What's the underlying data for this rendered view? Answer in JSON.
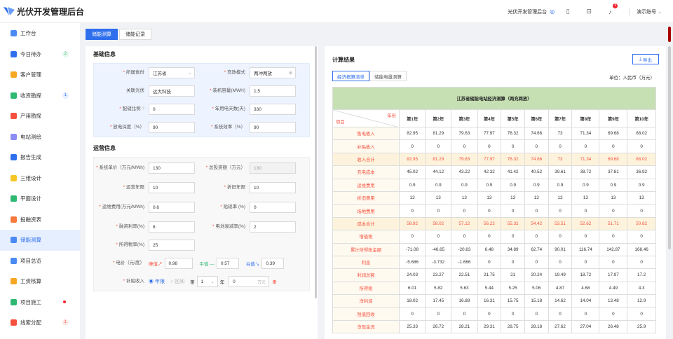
{
  "app": {
    "title": "光伏开发管理后台",
    "sys_link": "光伏开发管理后台",
    "notif_count": "3",
    "user": "演示账号"
  },
  "sidebar": [
    {
      "label": "工作台",
      "color": "#4a8af4",
      "count": "",
      "ctype": ""
    },
    {
      "label": "今日待办",
      "color": "#2f6fed",
      "count": "2",
      "ctype": "g"
    },
    {
      "label": "客户管理",
      "color": "#f5a623",
      "count": "",
      "ctype": ""
    },
    {
      "label": "收资勘探",
      "color": "#2eb872",
      "count": "1",
      "ctype": "b"
    },
    {
      "label": "产用勘探",
      "color": "#f5503d",
      "count": "",
      "ctype": ""
    },
    {
      "label": "电站测绘",
      "color": "#8c8cf5",
      "count": "",
      "ctype": ""
    },
    {
      "label": "报告生成",
      "color": "#2f6fed",
      "count": "",
      "ctype": ""
    },
    {
      "label": "三维设计",
      "color": "#f5c623",
      "count": "",
      "ctype": ""
    },
    {
      "label": "平面设计",
      "color": "#2eb872",
      "count": "",
      "ctype": ""
    },
    {
      "label": "投融资表",
      "color": "#f57a3d",
      "count": "",
      "ctype": ""
    },
    {
      "label": "储能测算",
      "color": "#4a8af4",
      "count": "",
      "ctype": ""
    },
    {
      "label": "项目总览",
      "color": "#4a8af4",
      "count": "",
      "ctype": ""
    },
    {
      "label": "工资核算",
      "color": "#f5a623",
      "count": "",
      "ctype": ""
    },
    {
      "label": "项目施工",
      "color": "#2eb872",
      "count": "",
      "ctype": "dot"
    },
    {
      "label": "线索分配",
      "color": "#f5503d",
      "count": "1",
      "ctype": "r"
    }
  ],
  "tabs": {
    "calc": "储能测算",
    "record": "储能记录"
  },
  "basic": {
    "title": "基础信息",
    "province_l": "所属省份",
    "province": "江苏省",
    "mode_l": "充放模式",
    "mode": "两冲两放",
    "link_l": "关联光伏",
    "link": "远大科技",
    "cap_l": "装机容量(MWH)",
    "cap": "1.5",
    "ratio_l": "配储比例",
    "ratio": "0",
    "days_l": "年用电天数(天)",
    "days": "330",
    "dod_l": "放电深度（%）",
    "dod": "90",
    "eff_l": "系统效率（%）",
    "eff": "90"
  },
  "ops": {
    "title": "运营信息",
    "price_l": "系统单价（万元/MWh)",
    "price": "130",
    "invest_l": "总投资额（万元）",
    "invest": "130",
    "years_l": "运营年限",
    "years": "10",
    "dep_l": "折旧年限",
    "dep": "10",
    "opex_l": "运维费用(万元/MWh)",
    "opex": "0.6",
    "rate_l": "贴现率 (%)",
    "rate": "0",
    "fin_l": "融资利率(%)",
    "fin": "8",
    "decay_l": "电池衰减率(%)",
    "decay": "2",
    "tax_l": "所得税率(%)",
    "tax": "25",
    "elec_l": "电价（元/度）",
    "peak_l": "峰值↗",
    "peak": "0.98",
    "flat_l": "平值 —",
    "flat": "0.57",
    "valley_l": "谷值↘",
    "valley": "0.39",
    "sub_l": "补贴收入",
    "sub_opt1": "年限",
    "sub_opt2": "区间",
    "sub_first": "第",
    "sub_year": "1",
    "sub_yr": "年",
    "sub_val": "0",
    "sub_unit": "万元"
  },
  "result": {
    "title": "计算结果",
    "export": "导出",
    "tab1": "经济概算清单",
    "tab2": "储能电量测算",
    "unit": "单位：人民币（万元）",
    "table_title": "江苏省储能电站经济测算（两充两放）",
    "corner_top": "年份",
    "corner_bottom": "项目",
    "years": [
      "第1年",
      "第2年",
      "第3年",
      "第4年",
      "第5年",
      "第6年",
      "第7年",
      "第8年",
      "第9年",
      "第10年"
    ],
    "rows": [
      {
        "name": "售电收入",
        "hl": false,
        "v": [
          "82.95",
          "81.29",
          "79.63",
          "77.97",
          "76.32",
          "74.66",
          "73",
          "71.34",
          "69.68",
          "68.02"
        ]
      },
      {
        "name": "补贴收入",
        "hl": false,
        "v": [
          "0",
          "0",
          "0",
          "0",
          "0",
          "0",
          "0",
          "0",
          "0",
          "0"
        ]
      },
      {
        "name": "收入合计",
        "hl": true,
        "v": [
          "82.95",
          "81.29",
          "79.63",
          "77.97",
          "76.32",
          "74.66",
          "73",
          "71.34",
          "69.68",
          "68.02"
        ]
      },
      {
        "name": "充电成本",
        "hl": false,
        "v": [
          "45.02",
          "44.12",
          "43.22",
          "42.32",
          "41.42",
          "40.52",
          "39.61",
          "38.72",
          "37.81",
          "36.92"
        ]
      },
      {
        "name": "运维费用",
        "hl": false,
        "v": [
          "0.9",
          "0.9",
          "0.9",
          "0.9",
          "0.9",
          "0.9",
          "0.9",
          "0.9",
          "0.9",
          "0.9"
        ]
      },
      {
        "name": "折旧费用",
        "hl": false,
        "v": [
          "13",
          "13",
          "13",
          "13",
          "13",
          "13",
          "13",
          "13",
          "13",
          "13"
        ]
      },
      {
        "name": "场地费用",
        "hl": false,
        "v": [
          "0",
          "0",
          "0",
          "0",
          "0",
          "0",
          "0",
          "0",
          "0",
          "0"
        ]
      },
      {
        "name": "成本合计",
        "hl": true,
        "v": [
          "58.92",
          "58.02",
          "57.12",
          "56.22",
          "55.32",
          "54.42",
          "53.51",
          "52.62",
          "51.71",
          "50.82"
        ]
      },
      {
        "name": "增值税",
        "hl": false,
        "v": [
          "0",
          "0",
          "0",
          "0",
          "0",
          "0",
          "0",
          "0",
          "0",
          "0"
        ]
      },
      {
        "name": "累计所得税金额",
        "hl": false,
        "v": [
          "-71.08",
          "-46.65",
          "-20.83",
          "6.48",
          "34.89",
          "62.74",
          "90.01",
          "116.74",
          "142.87",
          "168.46"
        ]
      },
      {
        "name": "利息",
        "hl": false,
        "v": [
          "-5.686",
          "-3.732",
          "-1.666",
          "0",
          "0",
          "0",
          "0",
          "0",
          "0",
          "0"
        ]
      },
      {
        "name": "利润总额",
        "hl": false,
        "v": [
          "24.03",
          "23.27",
          "22.51",
          "21.75",
          "21",
          "20.24",
          "19.49",
          "18.72",
          "17.97",
          "17.2"
        ]
      },
      {
        "name": "所得税",
        "hl": false,
        "v": [
          "6.01",
          "5.82",
          "5.63",
          "5.44",
          "5.25",
          "5.06",
          "4.87",
          "4.68",
          "4.49",
          "4.3"
        ]
      },
      {
        "name": "净利润",
        "hl": false,
        "v": [
          "18.02",
          "17.45",
          "16.88",
          "16.31",
          "15.75",
          "15.18",
          "14.62",
          "14.04",
          "13.48",
          "12.9"
        ]
      },
      {
        "name": "残值回收",
        "hl": false,
        "v": [
          "0",
          "0",
          "0",
          "0",
          "0",
          "0",
          "0",
          "0",
          "0",
          "0"
        ]
      },
      {
        "name": "净现金流",
        "hl": false,
        "v": [
          "25.33",
          "26.72",
          "28.21",
          "29.31",
          "28.75",
          "28.18",
          "27.62",
          "27.04",
          "26.48",
          "25.9"
        ]
      }
    ]
  }
}
